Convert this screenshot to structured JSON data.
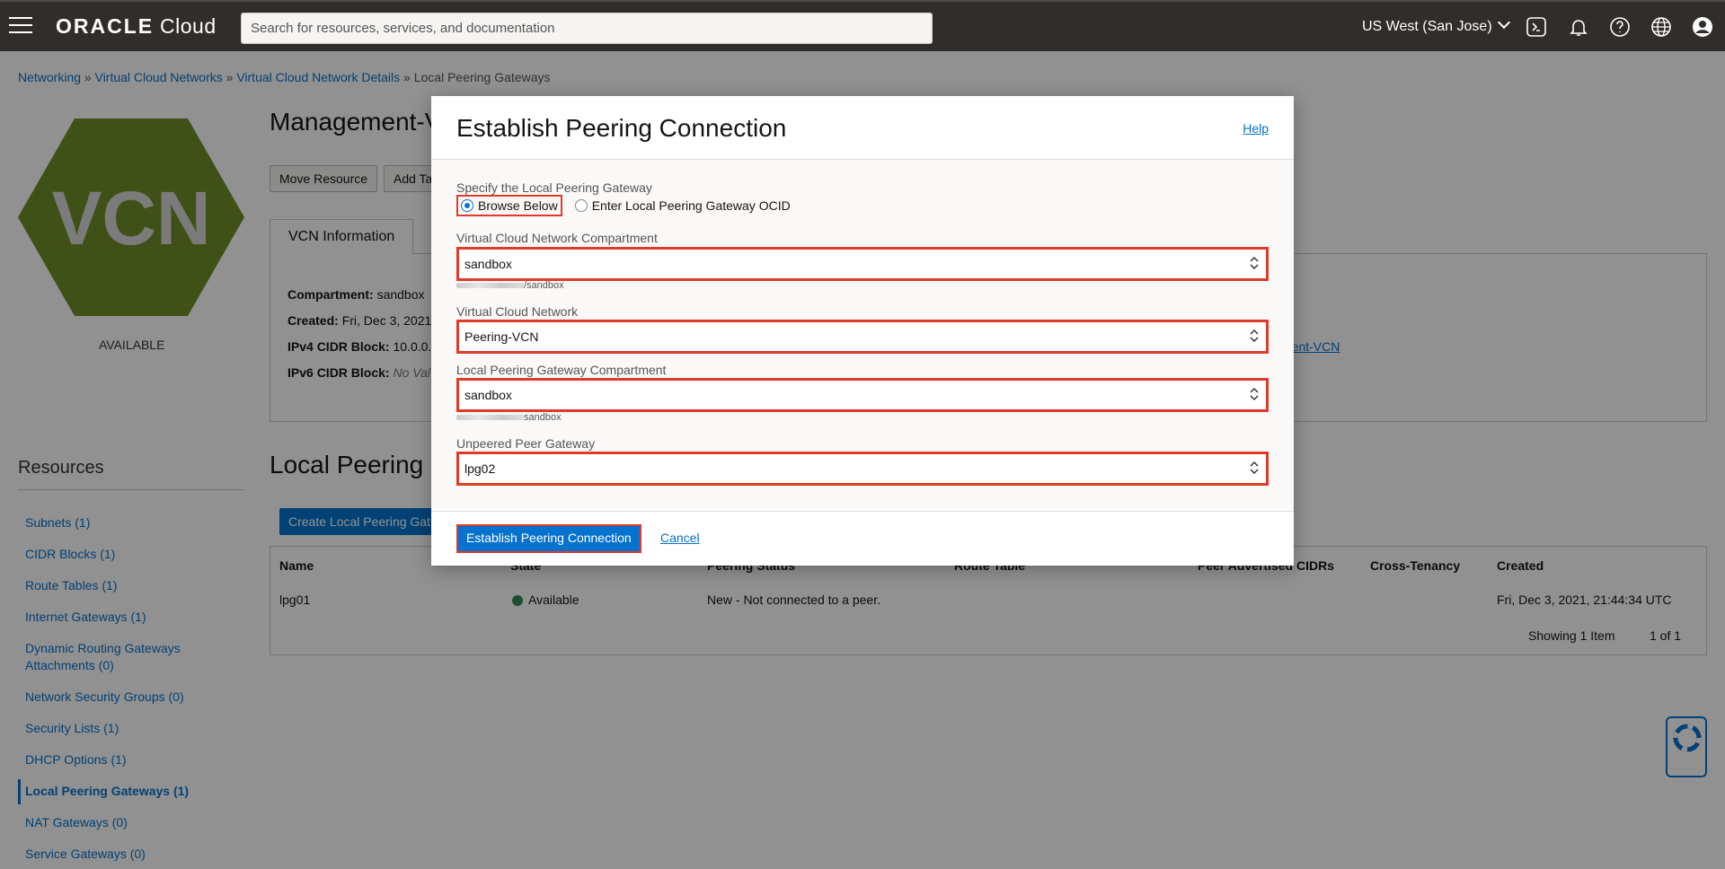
{
  "header": {
    "logo_brand": "ORACLE",
    "logo_product": "Cloud",
    "search_placeholder": "Search for resources, services, and documentation",
    "region": "US West (San Jose)"
  },
  "breadcrumb": {
    "items": [
      "Networking",
      "Virtual Cloud Networks",
      "Virtual Cloud Network Details"
    ],
    "current": "Local Peering Gateways",
    "separator": "»"
  },
  "vcn": {
    "icon_text": "VCN",
    "status": "AVAILABLE",
    "title": "Management-V",
    "buttons": [
      "Move Resource",
      "Add Ta"
    ],
    "tab": "VCN Information",
    "info": [
      {
        "label": "Compartment:",
        "value": "sandbox"
      },
      {
        "label": "Created:",
        "value": "Fri, Dec 3, 2021"
      },
      {
        "label": "IPv4 CIDR Block:",
        "value": "10.0.0."
      },
      {
        "label": "IPv6 CIDR Block:",
        "value": "No Val"
      }
    ],
    "link_fragment": "ment-VCN"
  },
  "resources": {
    "title": "Resources",
    "items": [
      "Subnets (1)",
      "CIDR Blocks (1)",
      "Route Tables (1)",
      "Internet Gateways (1)",
      "Dynamic Routing Gateways Attachments (0)",
      "Network Security Groups (0)",
      "Security Lists (1)",
      "DHCP Options (1)",
      "Local Peering Gateways (1)",
      "NAT Gateways (0)",
      "Service Gateways (0)"
    ]
  },
  "lpg": {
    "title": "Local Peering",
    "create_button": "Create Local Peering Gat",
    "columns": [
      "Name",
      "State",
      "Peering Status",
      "Route Table",
      "Peer Advertised CIDRs",
      "Cross-Tenancy",
      "Created"
    ],
    "rows": [
      {
        "name": "lpg01",
        "state": "Available",
        "peering": "New - Not connected to a peer.",
        "created": "Fri, Dec 3, 2021, 21:44:34 UTC"
      }
    ],
    "showing": "Showing 1 Item",
    "pager": "1 of 1"
  },
  "modal": {
    "title": "Establish Peering Connection",
    "help": "Help",
    "specify_label": "Specify the Local Peering Gateway",
    "radio_browse": "Browse Below",
    "radio_ocid": "Enter Local Peering Gateway OCID",
    "vcn_compartment_label": "Virtual Cloud Network Compartment",
    "vcn_compartment_value": "sandbox",
    "vcn_compartment_path": "/sandbox",
    "vcn_label": "Virtual Cloud Network",
    "vcn_value": "Peering-VCN",
    "lpg_compartment_label": "Local Peering Gateway Compartment",
    "lpg_compartment_value": "sandbox",
    "lpg_compartment_path": "sandbox",
    "peer_label": "Unpeered Peer Gateway",
    "peer_value": "lpg02",
    "submit": "Establish Peering Connection",
    "cancel": "Cancel"
  },
  "colors": {
    "accent": "#0572ce",
    "highlight": "#e03a2a",
    "topbar": "#312d2a",
    "vcn_green": "#6f8f2a"
  }
}
